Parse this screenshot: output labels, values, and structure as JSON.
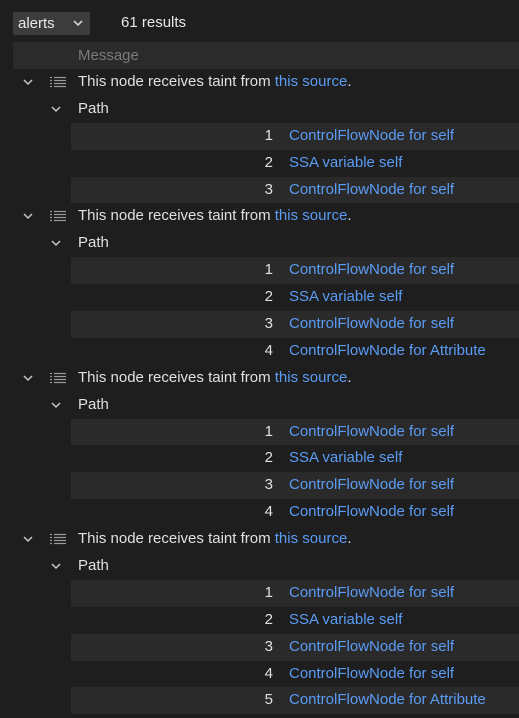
{
  "toolbar": {
    "view_select": "alerts",
    "result_count": "61 results"
  },
  "table": {
    "message_header": "Message"
  },
  "alerts": [
    {
      "message_prefix": "This node receives taint from ",
      "message_link": "this source",
      "message_suffix": ".",
      "path_label": "Path",
      "steps": [
        {
          "num": "1",
          "text": "ControlFlowNode for self"
        },
        {
          "num": "2",
          "text": "SSA variable self"
        },
        {
          "num": "3",
          "text": "ControlFlowNode for self"
        }
      ]
    },
    {
      "message_prefix": "This node receives taint from ",
      "message_link": "this source",
      "message_suffix": ".",
      "path_label": "Path",
      "steps": [
        {
          "num": "1",
          "text": "ControlFlowNode for self"
        },
        {
          "num": "2",
          "text": "SSA variable self"
        },
        {
          "num": "3",
          "text": "ControlFlowNode for self"
        },
        {
          "num": "4",
          "text": "ControlFlowNode for Attribute"
        }
      ]
    },
    {
      "message_prefix": "This node receives taint from ",
      "message_link": "this source",
      "message_suffix": ".",
      "path_label": "Path",
      "steps": [
        {
          "num": "1",
          "text": "ControlFlowNode for self"
        },
        {
          "num": "2",
          "text": "SSA variable self"
        },
        {
          "num": "3",
          "text": "ControlFlowNode for self"
        },
        {
          "num": "4",
          "text": "ControlFlowNode for self"
        }
      ]
    },
    {
      "message_prefix": "This node receives taint from ",
      "message_link": "this source",
      "message_suffix": ".",
      "path_label": "Path",
      "steps": [
        {
          "num": "1",
          "text": "ControlFlowNode for self"
        },
        {
          "num": "2",
          "text": "SSA variable self"
        },
        {
          "num": "3",
          "text": "ControlFlowNode for self"
        },
        {
          "num": "4",
          "text": "ControlFlowNode for self"
        },
        {
          "num": "5",
          "text": "ControlFlowNode for Attribute"
        }
      ]
    }
  ],
  "colors": {
    "background": "#1e1e1e",
    "link": "#5b9cf5",
    "text": "#e0e0e0",
    "muted": "#7a7a7a",
    "row_shade": "#2a2a2a"
  }
}
